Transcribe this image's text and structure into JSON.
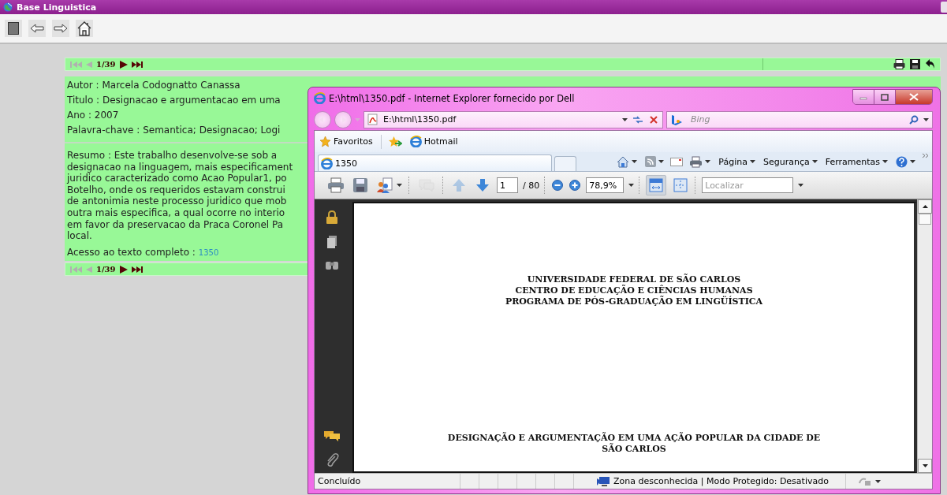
{
  "app": {
    "title": "Base Linguistica"
  },
  "pager_top": {
    "position": "1/39",
    "buttons": [
      {
        "kind": "first",
        "disabled": true
      },
      {
        "kind": "prev",
        "disabled": true
      },
      {
        "kind": "next",
        "disabled": false
      },
      {
        "kind": "last",
        "disabled": false
      }
    ]
  },
  "record": {
    "fields": [
      "Autor : Marcela Codognatto Canassa",
      "Titulo : Designacao e argumentacao em uma",
      "Ano : 2007",
      "Palavra-chave : Semantica; Designacao; Logi"
    ],
    "abstract_lines": [
      "Resumo : Este trabalho desenvolve-se sob a",
      "designacao na linguagem, mais especificament",
      "juridico caracterizado como Acao Popular1, po",
      "Botelho, onde os requeridos estavam construi",
      "de antonimia neste processo juridico que mob",
      "outra mais especifica, a qual ocorre no interio",
      "em favor da preservacao da Praca Coronel Pa",
      "local."
    ],
    "full_text": {
      "label": "Acesso ao texto completo  :",
      "link": "1350"
    }
  },
  "pager_bottom": {
    "position": "1/39",
    "buttons": [
      {
        "kind": "first",
        "disabled": true
      },
      {
        "kind": "prev",
        "disabled": true
      },
      {
        "kind": "next",
        "disabled": false
      },
      {
        "kind": "last",
        "disabled": false
      }
    ]
  },
  "browser": {
    "title": "E:\\html\\1350.pdf - Internet Explorer fornecido por Dell",
    "address": "E:\\html\\1350.pdf",
    "search_placeholder": "Bing",
    "favorites": [
      "Favoritos",
      "Hotmail"
    ],
    "tabs": [
      {
        "label": "1350",
        "selected": true
      }
    ],
    "commands": [
      "Página",
      "Segurança",
      "Ferramentas"
    ],
    "pdf": {
      "buttons": [
        {
          "kind": "print",
          "disabled": false
        },
        {
          "kind": "save",
          "disabled": false
        },
        {
          "kind": "share",
          "disabled": false
        },
        {
          "kind": "comment",
          "disabled": true
        },
        {
          "kind": "prev-page",
          "disabled": true
        },
        {
          "kind": "next-page",
          "disabled": false
        }
      ],
      "page": "1",
      "page_count": "/ 80",
      "zoom": "78,9%",
      "views": [
        {
          "kind": "fit-width",
          "selected": true
        },
        {
          "kind": "fit-page",
          "selected": false
        }
      ],
      "find_placeholder": "Localizar",
      "heading_lines": [
        "UNIVERSIDADE FEDERAL DE SÃO CARLOS",
        "CENTRO DE EDUCAÇÃO E CIÊNCIAS HUMANAS",
        "PROGRAMA DE PÓS-GRADUAÇÃO EM LINGÜÍSTICA"
      ],
      "title_lines": [
        "DESIGNAÇÃO E ARGUMENTAÇÃO EM UMA AÇÃO POPULAR DA CIDADE DE",
        "SÃO CARLOS"
      ]
    },
    "status": {
      "text": "Concluído",
      "zone": "Zona desconhecida | Modo Protegido: Desativado"
    }
  }
}
